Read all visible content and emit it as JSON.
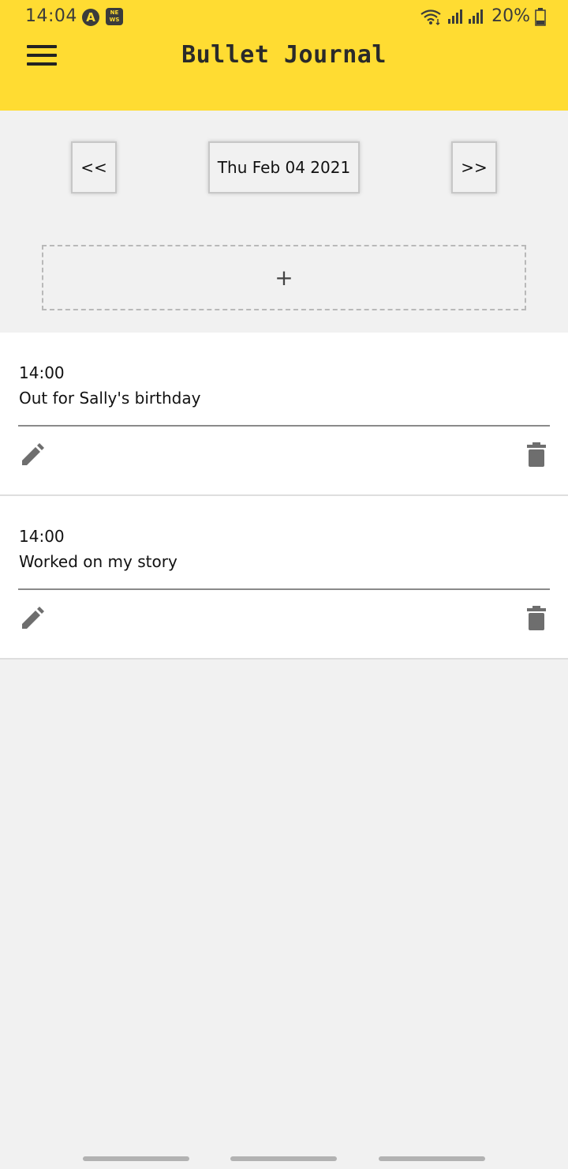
{
  "status_bar": {
    "time": "14:04",
    "a_icon": "A",
    "news_icon_line1": "NE",
    "news_icon_line2": "WS",
    "battery": "20%"
  },
  "header": {
    "title": "Bullet Journal",
    "menu_icon": "hamburger-menu-icon",
    "background_color": "#ffdc32"
  },
  "date_nav": {
    "prev_label": "<<",
    "date_label": "Thu Feb 04 2021",
    "next_label": ">>"
  },
  "add_entry": {
    "label": "+"
  },
  "entries": [
    {
      "time": "14:00",
      "text": "Out for Sally's birthday",
      "edit_icon": "pencil-icon",
      "delete_icon": "trash-icon"
    },
    {
      "time": "14:00",
      "text": "Worked on my story",
      "edit_icon": "pencil-icon",
      "delete_icon": "trash-icon"
    }
  ]
}
